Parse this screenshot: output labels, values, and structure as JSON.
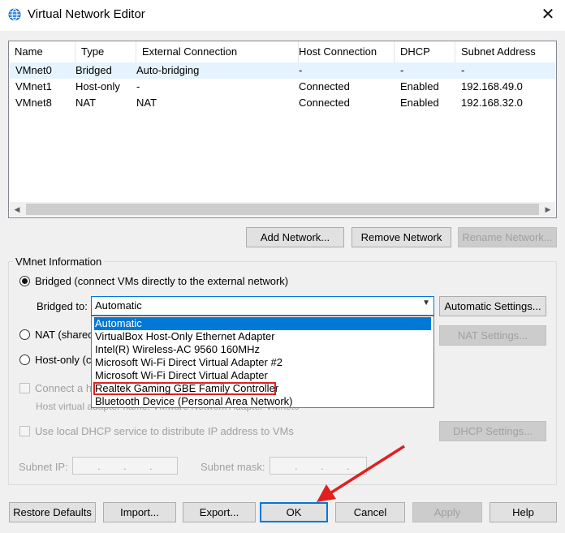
{
  "window": {
    "title": "Virtual Network Editor",
    "close_glyph": "✕"
  },
  "table": {
    "columns": [
      "Name",
      "Type",
      "External Connection",
      "Host Connection",
      "DHCP",
      "Subnet Address"
    ],
    "rows": [
      {
        "name": "VMnet0",
        "type": "Bridged",
        "external": "Auto-bridging",
        "host": "-",
        "dhcp": "-",
        "subnet": "-"
      },
      {
        "name": "VMnet1",
        "type": "Host-only",
        "external": "-",
        "host": "Connected",
        "dhcp": "Enabled",
        "subnet": "192.168.49.0"
      },
      {
        "name": "VMnet8",
        "type": "NAT",
        "external": "NAT",
        "host": "Connected",
        "dhcp": "Enabled",
        "subnet": "192.168.32.0"
      }
    ]
  },
  "network_buttons": {
    "add": "Add Network...",
    "remove": "Remove Network",
    "rename": "Rename Network..."
  },
  "vmnet_info": {
    "group_label": "VMnet Information",
    "bridged_label": "Bridged (connect VMs directly to the external network)",
    "bridged_to_label": "Bridged to:",
    "bridged_to_value": "Automatic",
    "automatic_settings": "Automatic Settings...",
    "nat_label": "NAT (shared",
    "nat_settings": "NAT Settings...",
    "host_only_label": "Host-only (c",
    "connect_host_label": "Connect a h",
    "host_adapter_label": "Host virtual adapter name: VMware Network Adapter VMnet0",
    "dhcp_label": "Use local DHCP service to distribute IP address to VMs",
    "dhcp_settings": "DHCP Settings...",
    "subnet_ip_label": "Subnet IP:",
    "subnet_mask_label": "Subnet mask:"
  },
  "dropdown": {
    "options": [
      "Automatic",
      "VirtualBox Host-Only Ethernet Adapter",
      "Intel(R) Wireless-AC 9560 160MHz",
      "Microsoft Wi-Fi Direct Virtual Adapter #2",
      "Microsoft Wi-Fi Direct Virtual Adapter",
      "Realtek Gaming GBE Family Controller",
      "Bluetooth Device (Personal Area Network)"
    ],
    "highlighted_index": 0,
    "boxed_index": 5
  },
  "footer": {
    "restore": "Restore Defaults",
    "import": "Import...",
    "export": "Export...",
    "ok": "OK",
    "cancel": "Cancel",
    "apply": "Apply",
    "help": "Help"
  },
  "colors": {
    "accent": "#0078d7",
    "annotation_red": "#e0201f"
  }
}
